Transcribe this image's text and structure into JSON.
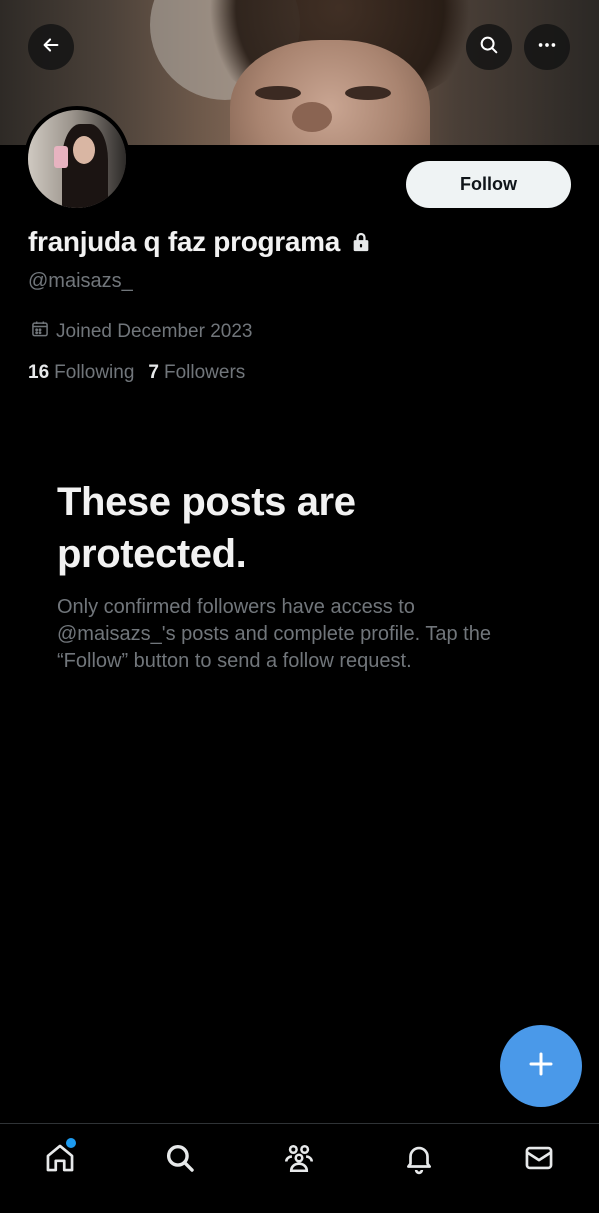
{
  "header": {
    "back_icon": "arrow-left-icon",
    "search_icon": "search-icon",
    "more_icon": "more-horizontal-icon"
  },
  "profile": {
    "display_name": "franjuda q faz programa",
    "handle": "@maisazs_",
    "protected_icon": "lock-icon",
    "joined": "Joined December 2023",
    "following_count": "16",
    "following_label": "Following",
    "followers_count": "7",
    "followers_label": "Followers",
    "follow_label": "Follow"
  },
  "protected_notice": {
    "title": "These posts are protected.",
    "body": "Only confirmed followers have access to @maisazs_'s posts and complete profile. Tap the “Follow” button to send a follow request."
  },
  "fab": {
    "icon": "plus-icon"
  },
  "bottom_nav": [
    {
      "icon": "home-icon",
      "has_notification_dot": true
    },
    {
      "icon": "search-icon"
    },
    {
      "icon": "communities-icon"
    },
    {
      "icon": "bell-icon"
    },
    {
      "icon": "mail-icon"
    }
  ],
  "colors": {
    "background": "#000000",
    "text_primary": "#e7e9ea",
    "text_secondary": "#71767b",
    "follow_button_bg": "#eff3f4",
    "fab_bg": "#4a99e9",
    "notification_dot": "#1d9bf0"
  }
}
